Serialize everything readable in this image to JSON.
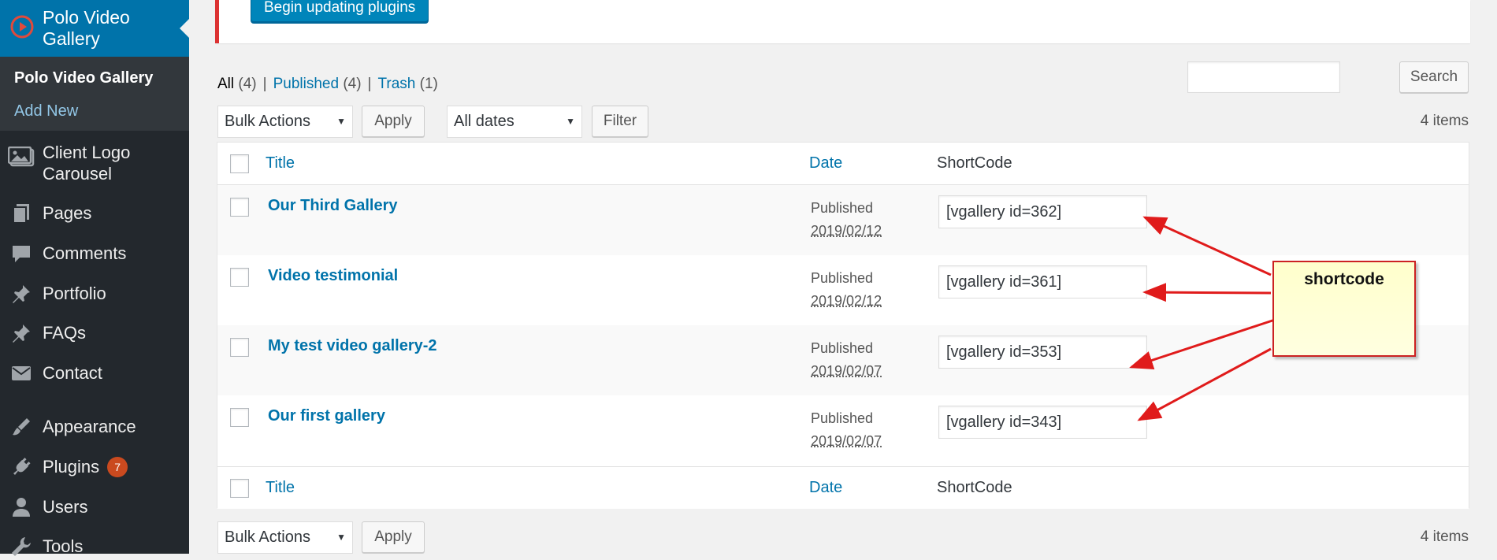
{
  "sidebar": {
    "active_menu": "Polo Video Gallery",
    "submenu": [
      "Polo Video Gallery",
      "Add New"
    ],
    "items": [
      {
        "label": "Client Logo",
        "label2": "Carousel",
        "icon": "image-icon"
      },
      {
        "label": "Pages",
        "icon": "pages-icon"
      },
      {
        "label": "Comments",
        "icon": "comments-icon"
      },
      {
        "label": "Portfolio",
        "icon": "pin-icon"
      },
      {
        "label": "FAQs",
        "icon": "pin-icon"
      },
      {
        "label": "Contact",
        "icon": "mail-icon"
      },
      {
        "label": "Appearance",
        "icon": "brush-icon"
      },
      {
        "label": "Plugins",
        "icon": "plugin-icon",
        "badge": "7"
      },
      {
        "label": "Users",
        "icon": "user-icon"
      },
      {
        "label": "Tools",
        "icon": "wrench-icon"
      }
    ]
  },
  "notice": {
    "button_label": "Begin updating plugins"
  },
  "filters": {
    "all_label": "All",
    "all_count": "(4)",
    "published_label": "Published",
    "published_count": "(4)",
    "trash_label": "Trash",
    "trash_count": "(1)"
  },
  "search": {
    "button_label": "Search",
    "value": ""
  },
  "tablenav": {
    "bulk_actions": "Bulk Actions",
    "apply": "Apply",
    "dates": "All dates",
    "filter": "Filter",
    "items_count": "4 items"
  },
  "columns": {
    "title": "Title",
    "date": "Date",
    "shortcode": "ShortCode"
  },
  "rows": [
    {
      "title": "Our Third Gallery",
      "status": "Published",
      "date": "2019/02/12",
      "shortcode": "[vgallery id=362]"
    },
    {
      "title": "Video testimonial",
      "status": "Published",
      "date": "2019/02/12",
      "shortcode": "[vgallery id=361]"
    },
    {
      "title": "My test video gallery-2",
      "status": "Published",
      "date": "2019/02/07",
      "shortcode": "[vgallery id=353]"
    },
    {
      "title": "Our first gallery",
      "status": "Published",
      "date": "2019/02/07",
      "shortcode": "[vgallery id=343]"
    }
  ],
  "annotation": {
    "label": "shortcode",
    "arrow_color": "#e01b1b"
  },
  "colors": {
    "sidebar": "#23282d",
    "active": "#0073aa",
    "link": "#0073aa",
    "notice_border": "#dc3232"
  }
}
